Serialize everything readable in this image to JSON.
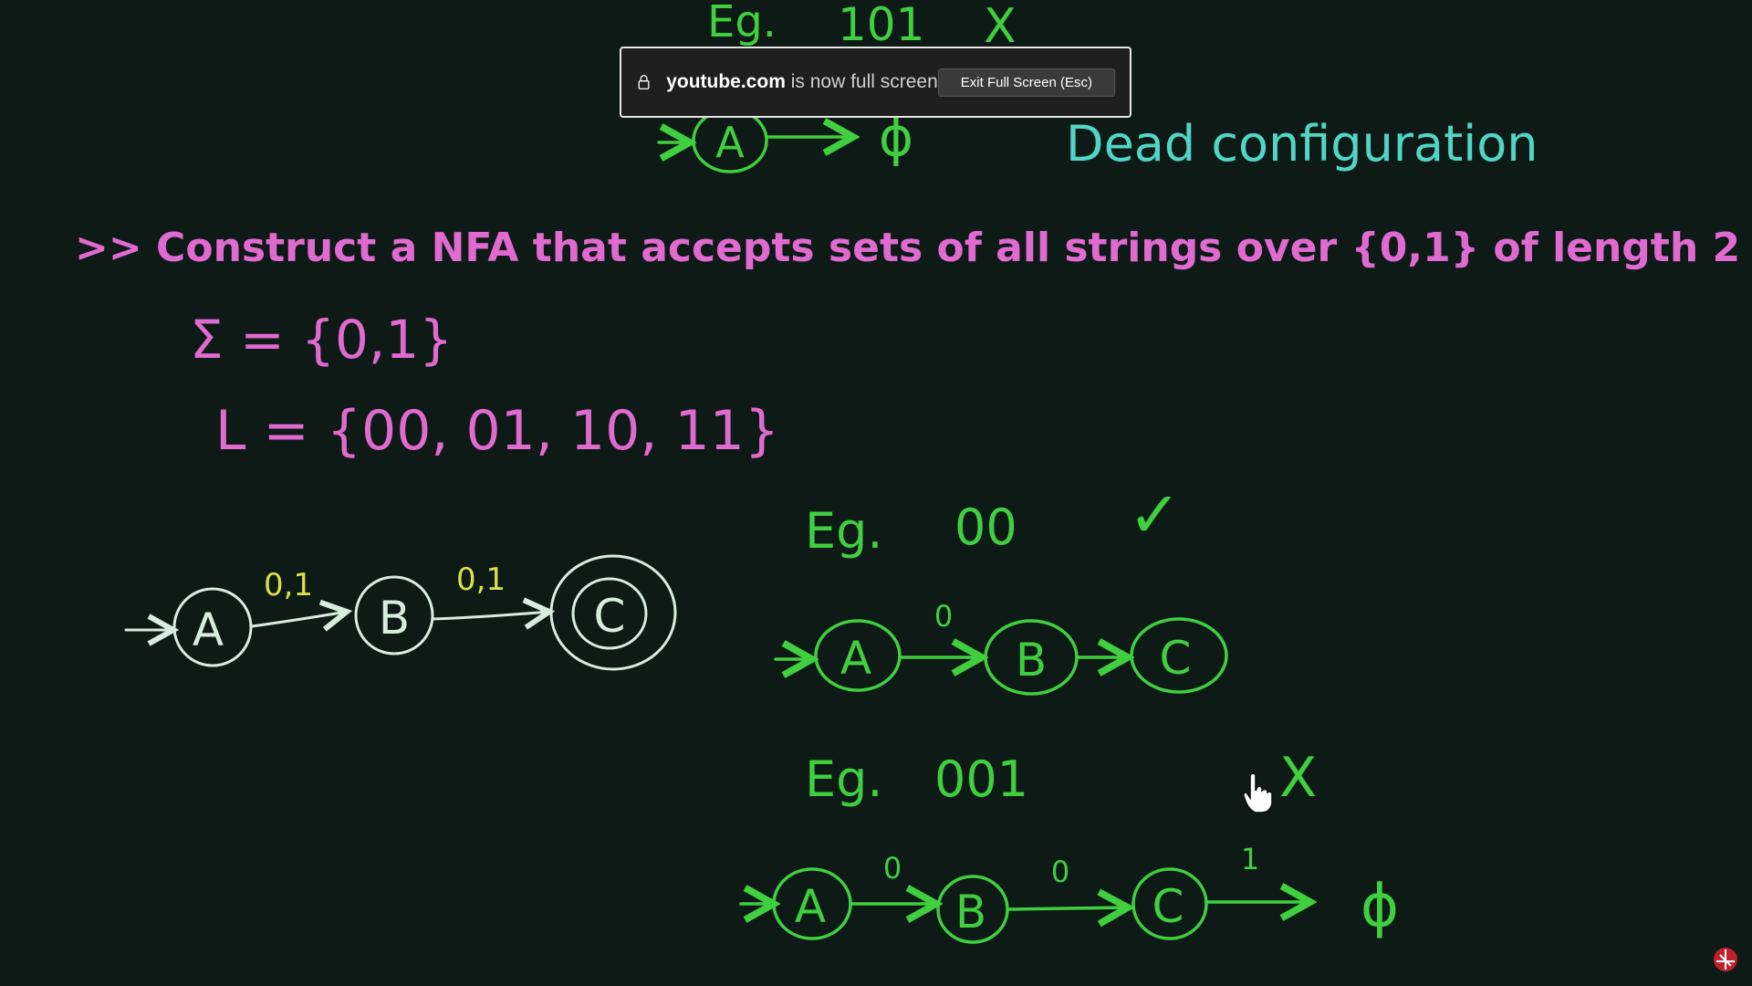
{
  "toast": {
    "domain": "youtube.com",
    "message": "is now full screen",
    "exit_button": "Exit Full Screen (Esc)"
  },
  "board": {
    "top_example": {
      "prefix": "Eg.",
      "string": "101",
      "mark": "X"
    },
    "top_diagram": {
      "states": [
        "A"
      ],
      "sink": "ϕ",
      "note": "Dead configuration"
    },
    "question": ">> Construct a NFA that accepts sets of all strings over {0,1} of length 2",
    "sigma": "Σ = {0,1}",
    "language": "L = {00, 01, 10, 11}",
    "nfa": {
      "states": [
        "A",
        "B",
        "C"
      ],
      "transition_labels": [
        "0,1",
        "0,1"
      ]
    },
    "example1": {
      "prefix": "Eg.",
      "string": "00",
      "mark": "✓",
      "states": [
        "A",
        "B",
        "C"
      ],
      "labels": [
        "0"
      ]
    },
    "example2": {
      "prefix": "Eg.",
      "string": "001",
      "mark": "X",
      "states": [
        "A",
        "B",
        "C"
      ],
      "labels": [
        "0",
        "0",
        "1"
      ],
      "sink": "ϕ"
    }
  },
  "colors": {
    "background": "#0e1a16",
    "green": "#3fcf3f",
    "white": "#d8ece0",
    "pink": "#e06ad0",
    "cyan": "#4fd6c6",
    "yellow": "#d8e04a"
  }
}
